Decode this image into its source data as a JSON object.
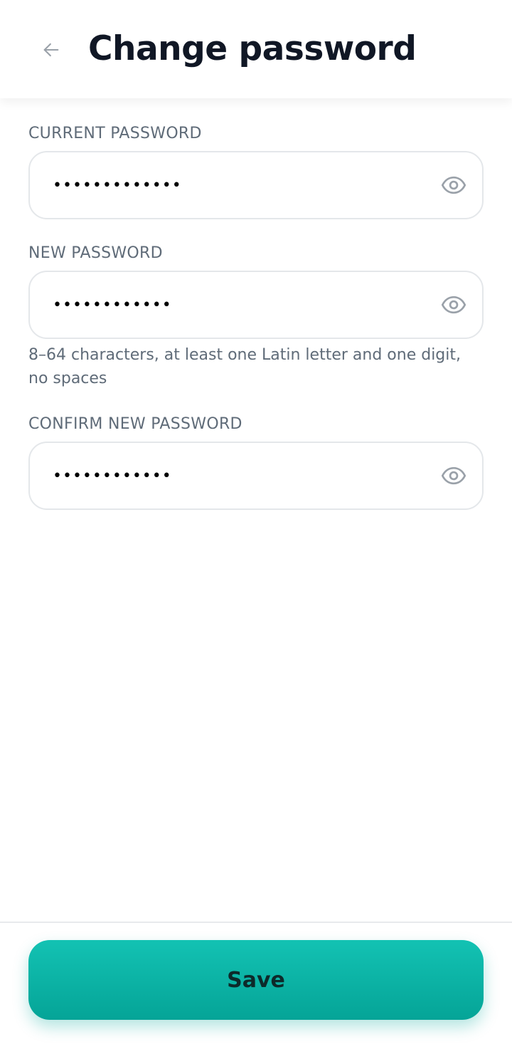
{
  "header": {
    "title": "Change password",
    "back_icon": "arrow-left-icon"
  },
  "fields": {
    "current": {
      "label": "CURRENT PASSWORD",
      "value": "•••••••••••••",
      "toggle_icon": "eye-icon"
    },
    "new": {
      "label": "NEW PASSWORD",
      "value": "••••••••••••",
      "hint": "8–64 characters, at least one Latin letter and one digit, no spaces",
      "toggle_icon": "eye-icon"
    },
    "confirm": {
      "label": "CONFIRM NEW PASSWORD",
      "value": "••••••••••••",
      "toggle_icon": "eye-icon"
    }
  },
  "footer": {
    "save_label": "Save"
  },
  "colors": {
    "title": "#101725",
    "label": "#5f6b78",
    "field_border": "#e4e7ea",
    "icon": "#9aa1a9",
    "accent_top": "#13c2b3",
    "accent_bottom": "#05a497"
  }
}
